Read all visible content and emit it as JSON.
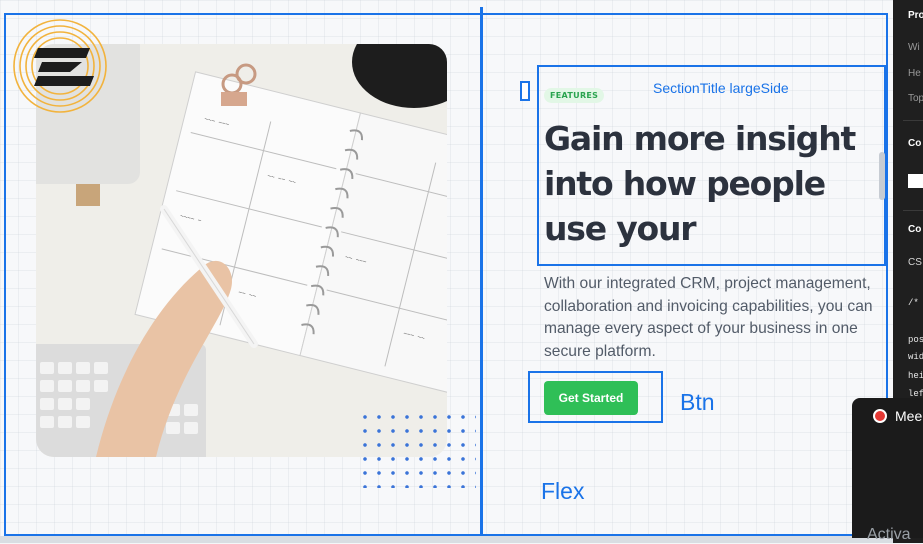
{
  "hero": {
    "tag": "FEATURES",
    "headline": "Gain more insight into how people use your",
    "body": "With our integrated CRM, project management, collaboration and invoicing capabilities, you can manage every aspect of your business in one secure platform.",
    "cta_label": "Get Started"
  },
  "annotations": {
    "section_title": "SectionTitle largeSide",
    "btn": "Btn",
    "flex": "Flex"
  },
  "side_panel": {
    "header": "Pro",
    "width_label": "Wi",
    "height_label": "He",
    "top_label": "Top",
    "section_1": "Co",
    "section_2": "Co",
    "css_label": "CS",
    "comment": "/*",
    "code_1": "pos",
    "code_2": "wid",
    "code_3": "hei",
    "code_4": "lef"
  },
  "meet_overlay": {
    "label": "Mee"
  },
  "os_watermark": "Activa",
  "colors": {
    "outline": "#1a73e8",
    "cta": "#2fbf57",
    "tag_bg": "#e2f7e6",
    "headline": "#2c323e"
  }
}
